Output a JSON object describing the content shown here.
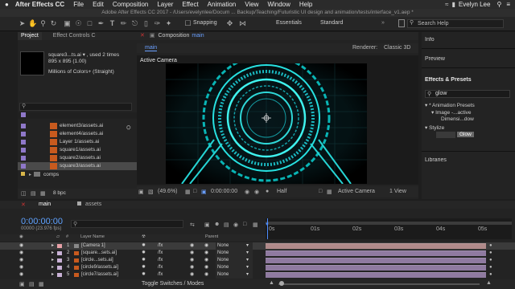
{
  "menubar": {
    "apple_glyph": "",
    "app_name": "After Effects CC",
    "items": [
      "File",
      "Edit",
      "Composition",
      "Layer",
      "Effect",
      "Animation",
      "View",
      "Window",
      "Help"
    ],
    "user": "Evelyn Lee",
    "status_icons": [
      "wifi-icon",
      "battery-icon",
      "search-icon",
      "menu-icon"
    ]
  },
  "titlebar": {
    "text": "Adobe After Effects CC 2017 - /Users/evelynlee/Docum ... Backup/Teaching/Futuristic UI design and animation/tests/interface_v1.aep *"
  },
  "toolbar": {
    "snapping_label": "Snapping",
    "workspaces": [
      "Essentials",
      "Standard"
    ],
    "search_placeholder": "Search Help"
  },
  "project": {
    "tab_label": "Project",
    "effect_controls_label": "Effect Controls C",
    "selected_name": "square3...ts.ai ▾ , used 2 times",
    "dimensions": "895 x 895 (1.00)",
    "color_info": "Millions of Colors+ (Straight)",
    "search_placeholder": "",
    "files": [
      {
        "name": "element3/assets.ai",
        "color": "#8f78c9"
      },
      {
        "name": "element4/assets.ai",
        "color": "#8f78c9"
      },
      {
        "name": "Layer 1/assets.ai",
        "color": "#8f78c9"
      },
      {
        "name": "square1/assets.ai",
        "color": "#8f78c9"
      },
      {
        "name": "square2/assets.ai",
        "color": "#8f78c9"
      },
      {
        "name": "square3/assets.ai",
        "color": "#8f78c9"
      }
    ],
    "folder": "comps",
    "bit_depth": "8 bpc"
  },
  "composition": {
    "tab_label": "Composition",
    "tab_name": "main",
    "subtab": "main",
    "renderer_label": "Renderer:",
    "renderer_value": "Classic 3D",
    "camera_label": "Active Camera",
    "zoom": "(49.6%)",
    "timecode": "0:00:00:00",
    "resolution": "Half",
    "view_camera": "Active Camera",
    "view_count": "1 View"
  },
  "right_panels": {
    "info": "Info",
    "preview": "Preview",
    "effects_title": "Effects & Presets",
    "search_value": "glow",
    "tree": [
      "* Animation Presets",
      "Image -...active",
      "Dimensi...dow",
      "Stylize",
      "Glow"
    ],
    "libraries": "Libraries"
  },
  "timeline": {
    "tabs": [
      "main",
      "assets"
    ],
    "timecode": "0:00:00:00",
    "fps_info": "00000 (23.976 fps)",
    "col_layer_name": "Layer Name",
    "col_parent": "Parent",
    "ruler": [
      "0s",
      "01s",
      "02s",
      "03s",
      "04s",
      "05s"
    ],
    "layers": [
      {
        "num": "1",
        "name": "[Camera 1]",
        "color": "#e7a0a7",
        "parent": "None",
        "bar": "#b08a8a"
      },
      {
        "num": "2",
        "name": "[square...sets.ai]",
        "color": "#c9b2d6",
        "parent": "None",
        "bar": "#8f7aa0"
      },
      {
        "num": "3",
        "name": "[circle...sets.ai]",
        "color": "#c9b2d6",
        "parent": "None",
        "bar": "#8f7aa0"
      },
      {
        "num": "4",
        "name": "[circle9/assets.ai]",
        "color": "#c9b2d6",
        "parent": "None",
        "bar": "#8f7aa0"
      },
      {
        "num": "5",
        "name": "[circle7/assets.ai]",
        "color": "#c9b2d6",
        "parent": "None",
        "bar": "#8f7aa0"
      }
    ],
    "toggle_label": "Toggle Switches / Modes"
  }
}
